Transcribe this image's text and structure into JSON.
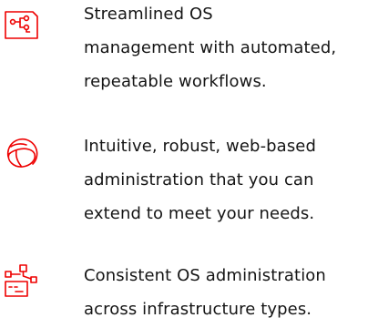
{
  "accent_color": "#ee0000",
  "text_color": "#151515",
  "features": [
    {
      "icon": "workflow-icon",
      "lines": [
        "Streamlined OS",
        "management with automated,",
        "repeatable workflows."
      ]
    },
    {
      "icon": "globe-icon",
      "lines": [
        "Intuitive, robust, web-based",
        "administration that you can",
        "extend to meet your needs."
      ]
    },
    {
      "icon": "infrastructure-icon",
      "lines": [
        "Consistent OS administration",
        "across infrastructure types."
      ]
    }
  ]
}
